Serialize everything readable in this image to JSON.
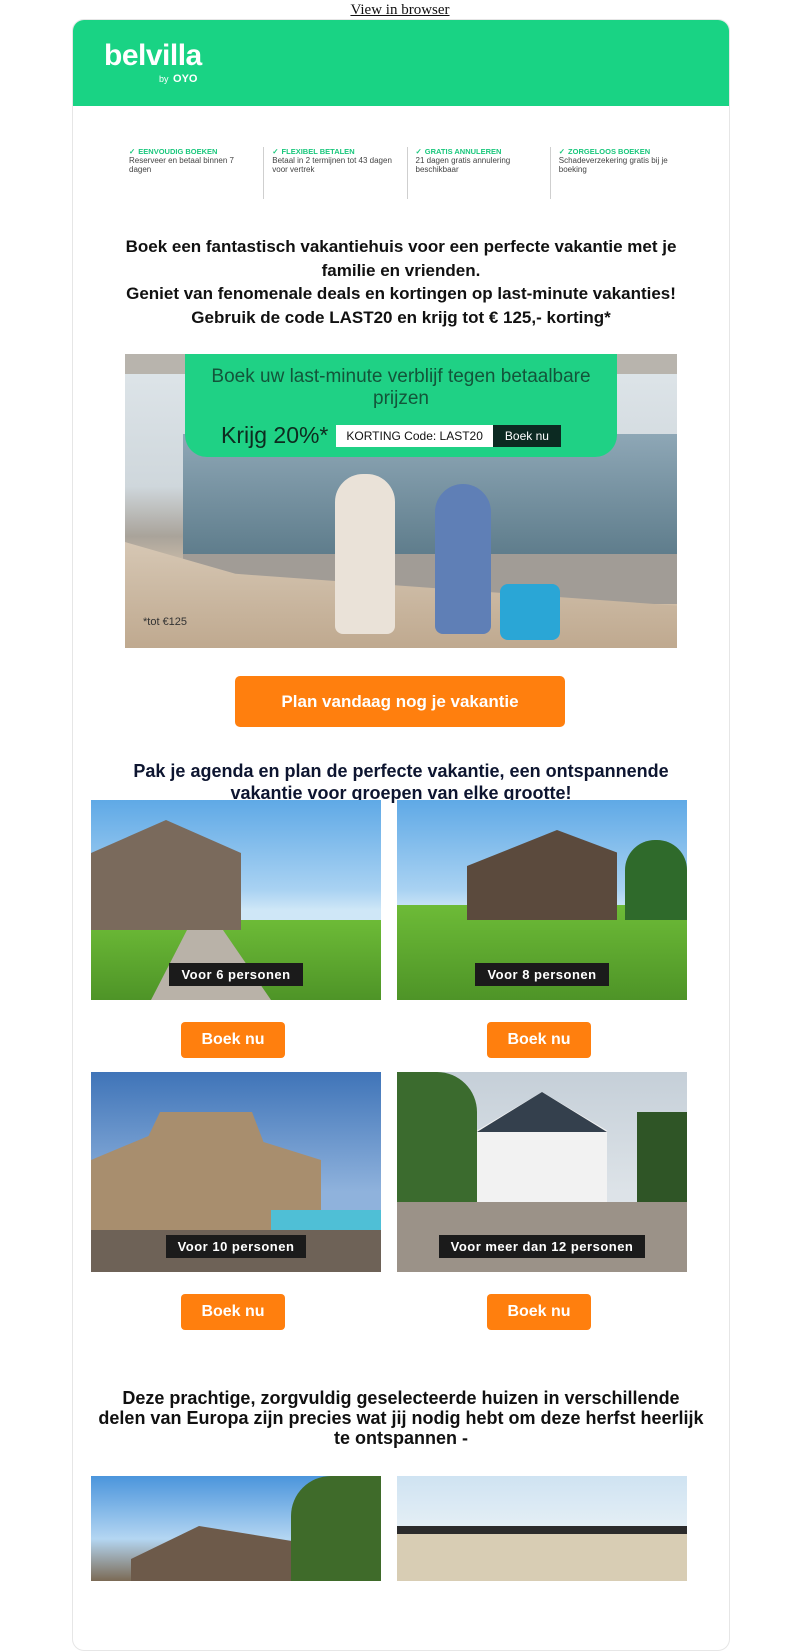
{
  "top": {
    "view_in_browser": "View in browser"
  },
  "header": {
    "logo_word": "belvilla",
    "logo_by": "by",
    "logo_brand": "OYO",
    "bg": "#19d384"
  },
  "usps": [
    {
      "title": "Eenvoudig boeken",
      "desc": "Reserveer en betaal binnen 7 dagen"
    },
    {
      "title": "Flexibel betalen",
      "desc": "Betaal in 2 termijnen tot 43 dagen voor vertrek"
    },
    {
      "title": "Gratis annuleren",
      "desc": "21 dagen gratis annulering beschikbaar"
    },
    {
      "title": "Zorgeloos boeken",
      "desc": "Schadeverzekering gratis bij je boeking"
    }
  ],
  "intro": {
    "line1": "Boek een fantastisch vakantiehuis voor een perfecte vakantie met je familie en vrienden.",
    "line2": "Geniet van fenomenale deals en kortingen op last-minute vakanties!",
    "line3": "Gebruik  de code LAST20 en krijg tot € 125,- korting*"
  },
  "hero": {
    "title": "Boek uw last-minute verblijf tegen betaalbare prijzen",
    "discount": "Krijg 20%*",
    "code": "KORTING Code: LAST20",
    "button": "Boek nu",
    "fine_print": "*tot €125"
  },
  "cta": {
    "label": "Plan vandaag nog je vakantie",
    "color": "#ff7f0e"
  },
  "section1": {
    "title": "Pak je agenda en plan de perfecte vakantie, een ontspannende vakantie voor groepen van elke grootte!"
  },
  "houses": [
    {
      "caption": "Voor 6 personen",
      "button": "Boek nu"
    },
    {
      "caption": "Voor 8 personen",
      "button": "Boek nu"
    },
    {
      "caption": "Voor 10 personen",
      "button": "Boek nu"
    },
    {
      "caption": "Voor meer dan 12 personen",
      "button": "Boek nu"
    }
  ],
  "section2": {
    "title": "Deze prachtige, zorgvuldig geselecteerde huizen in verschillende delen van Europa zijn precies wat jij nodig hebt om deze herfst heerlijk te ontspannen -"
  }
}
